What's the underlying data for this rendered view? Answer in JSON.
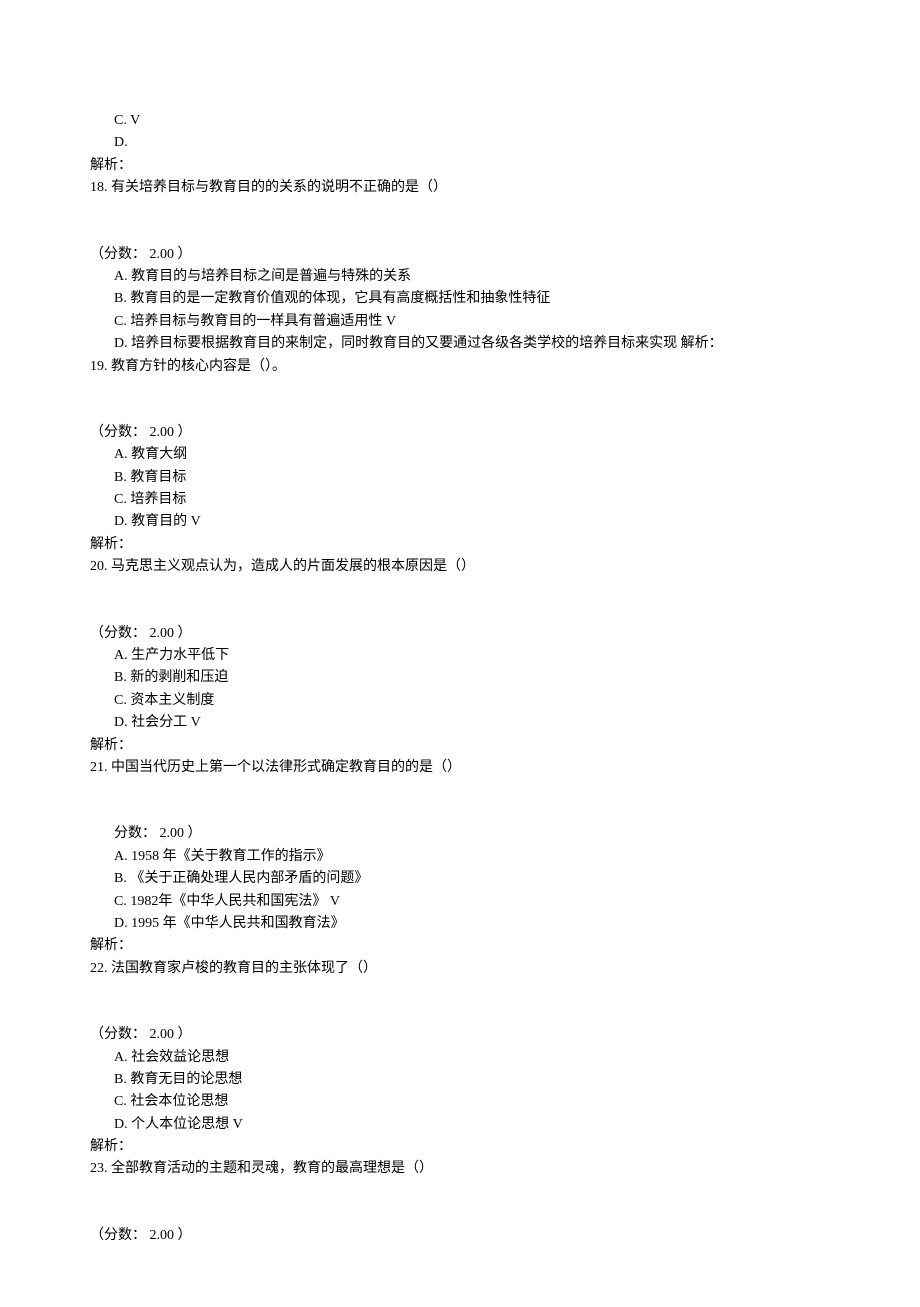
{
  "lines": [
    {
      "cls": "option",
      "t": "C.   V"
    },
    {
      "cls": "option",
      "t": "D."
    },
    {
      "cls": "label",
      "t": "解析："
    },
    {
      "cls": "question",
      "t": "18.  有关培养目标与教育目的的关系的说明不正确的是（）"
    },
    {
      "cls": "spacer",
      "t": ""
    },
    {
      "cls": "label",
      "t": "（分数：  2.00 ）"
    },
    {
      "cls": "option",
      "t": "A.  教育目的与培养目标之间是普遍与特殊的关系"
    },
    {
      "cls": "option",
      "t": "B.  教育目的是一定教育价值观的体现，它具有高度概括性和抽象性特征"
    },
    {
      "cls": "option",
      "t": "C.  培养目标与教育目的一样具有普遍适用性  V"
    },
    {
      "cls": "option",
      "t": "D.  培养目标要根据教育目的来制定，同时教育目的又要通过各级各类学校的培养目标来实现  解析："
    },
    {
      "cls": "question",
      "t": "19.  教育方针的核心内容是（）。"
    },
    {
      "cls": "spacer",
      "t": ""
    },
    {
      "cls": "label",
      "t": "（分数：  2.00 ）"
    },
    {
      "cls": "option",
      "t": "A.  教育大纲"
    },
    {
      "cls": "option",
      "t": "B.  教育目标"
    },
    {
      "cls": "option",
      "t": "C.  培养目标"
    },
    {
      "cls": "option",
      "t": "D.  教育目的  V"
    },
    {
      "cls": "label",
      "t": "解析："
    },
    {
      "cls": "question",
      "t": "20.  马克思主义观点认为，造成人的片面发展的根本原因是（）"
    },
    {
      "cls": "spacer",
      "t": ""
    },
    {
      "cls": "label",
      "t": "（分数：  2.00 ）"
    },
    {
      "cls": "option",
      "t": "A.  生产力水平低下"
    },
    {
      "cls": "option",
      "t": "B.  新的剥削和压迫"
    },
    {
      "cls": "option",
      "t": "C.  资本主义制度"
    },
    {
      "cls": "option",
      "t": "D.  社会分工  V"
    },
    {
      "cls": "label",
      "t": "解析："
    },
    {
      "cls": "question",
      "t": "21.  中国当代历史上第一个以法律形式确定教育目的的是（）"
    },
    {
      "cls": "spacer",
      "t": ""
    },
    {
      "cls": "option",
      "t": "分数：  2.00 ）"
    },
    {
      "cls": "option",
      "t": "A.  1958 年《关于教育工作的指示》"
    },
    {
      "cls": "option",
      "t": "B.  《关于正确处理人民内部矛盾的问题》"
    },
    {
      "cls": "option",
      "t": "C.  1982年《中华人民共和国宪法》       V"
    },
    {
      "cls": "option",
      "t": "D.  1995 年《中华人民共和国教育法》"
    },
    {
      "cls": "label",
      "t": "解析："
    },
    {
      "cls": "question",
      "t": "22.  法国教育家卢梭的教育目的主张体现了（）"
    },
    {
      "cls": "spacer",
      "t": ""
    },
    {
      "cls": "label",
      "t": "（分数：  2.00 ）"
    },
    {
      "cls": "option",
      "t": "A.  社会效益论思想"
    },
    {
      "cls": "option",
      "t": "B.  教育无目的论思想"
    },
    {
      "cls": "option",
      "t": "C.  社会本位论思想"
    },
    {
      "cls": "option",
      "t": "D.  个人本位论思想  V"
    },
    {
      "cls": "label",
      "t": "解析："
    },
    {
      "cls": "question",
      "t": "23.  全部教育活动的主题和灵魂，教育的最高理想是（）"
    },
    {
      "cls": "spacer",
      "t": ""
    },
    {
      "cls": "label",
      "t": "（分数：  2.00 ）"
    }
  ]
}
